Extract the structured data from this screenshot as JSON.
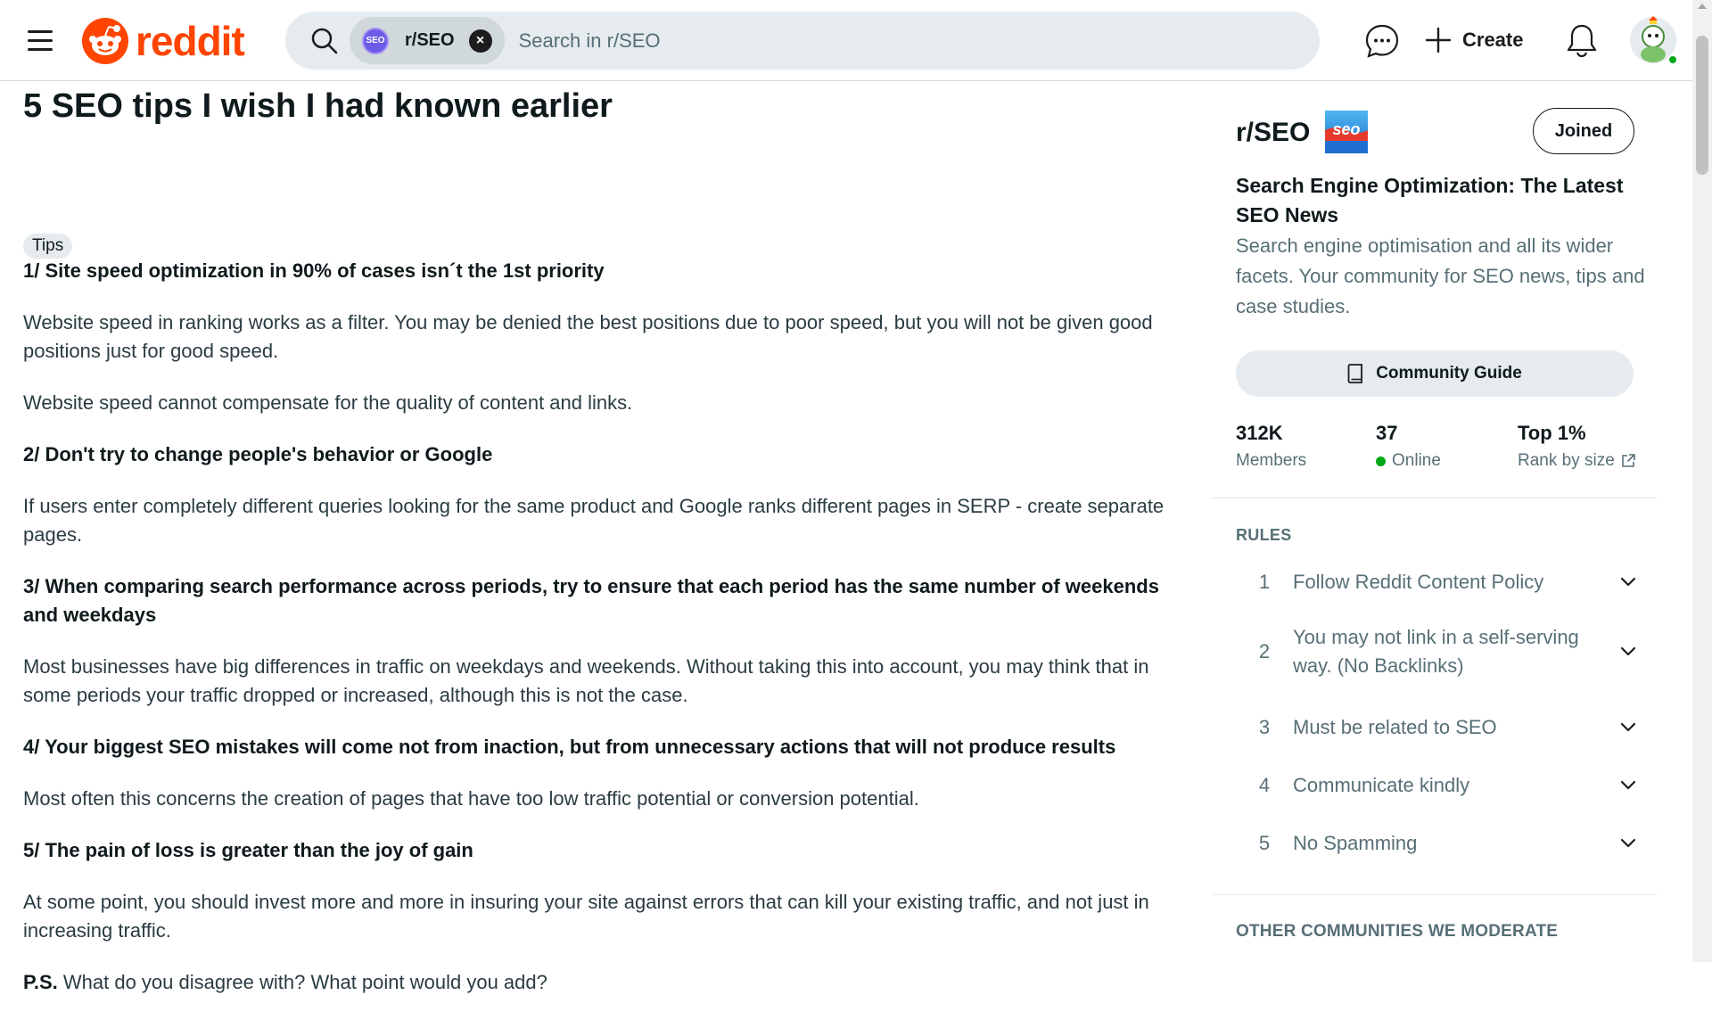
{
  "header": {
    "logo_text": "reddit",
    "search": {
      "chip_label": "r/SEO",
      "placeholder": "Search in r/SEO"
    },
    "create_label": "Create"
  },
  "post": {
    "title": "5 SEO tips I wish I had known earlier",
    "flair": "Tips",
    "sections": [
      {
        "heading": "1/ Site speed optimization in 90% of cases isn´t the 1st priority",
        "paragraphs": [
          "Website speed in ranking works as a filter. You may be denied the best positions due to poor speed, but you will not be given good positions just for good speed.",
          "Website speed cannot compensate for the quality of content and links."
        ]
      },
      {
        "heading": "2/ Don't try to change people's behavior or Google",
        "paragraphs": [
          "If users enter completely different queries looking for the same product and Google ranks different pages in SERP - create separate pages."
        ]
      },
      {
        "heading": "3/ When comparing search performance across periods, try to ensure that each period has the same number of weekends and weekdays",
        "paragraphs": [
          "Most businesses have big differences in traffic on weekdays and weekends. Without taking this into account, you may think that in some periods your traffic dropped or increased, although this is not the case."
        ]
      },
      {
        "heading": "4/ Your biggest SEO mistakes will come not from inaction, but from unnecessary actions that will not produce results",
        "paragraphs": [
          "Most often this concerns the creation of pages that have too low traffic potential or conversion potential."
        ]
      },
      {
        "heading": "5/ The pain of loss is greater than the joy of gain",
        "paragraphs": [
          "At some point, you should invest more and more in insuring your site against errors that can kill your existing traffic, and not just in increasing traffic."
        ]
      }
    ],
    "ps_label": "P.S.",
    "ps_text": "What do you disagree with? What point would you add?"
  },
  "sidebar": {
    "name": "r/SEO",
    "joined_label": "Joined",
    "title": "Search Engine Optimization: The Latest SEO News",
    "description": "Search engine optimisation and all its wider facets. Your community for SEO news, tips and case studies.",
    "guide_label": "Community Guide",
    "stats": {
      "members_value": "312K",
      "members_label": "Members",
      "online_value": "37",
      "online_label": "Online",
      "rank_value": "Top 1%",
      "rank_label": "Rank by size"
    },
    "rules_header": "RULES",
    "rules": [
      {
        "num": "1",
        "text": "Follow Reddit Content Policy"
      },
      {
        "num": "2",
        "text": "You may not link in a self-serving way. (No Backlinks)"
      },
      {
        "num": "3",
        "text": "Must be related to SEO"
      },
      {
        "num": "4",
        "text": "Communicate kindly"
      },
      {
        "num": "5",
        "text": "No Spamming"
      }
    ],
    "other_header": "OTHER COMMUNITIES WE MODERATE"
  },
  "colors": {
    "brand": "#ff4500",
    "online": "#01a816",
    "search_bg": "#e5ebee"
  },
  "icons": [
    "hamburger-icon",
    "reddit-logo-icon",
    "search-icon",
    "close-icon",
    "chat-icon",
    "plus-icon",
    "bell-icon",
    "user-avatar-icon",
    "book-icon",
    "external-link-icon",
    "chevron-down-icon"
  ]
}
